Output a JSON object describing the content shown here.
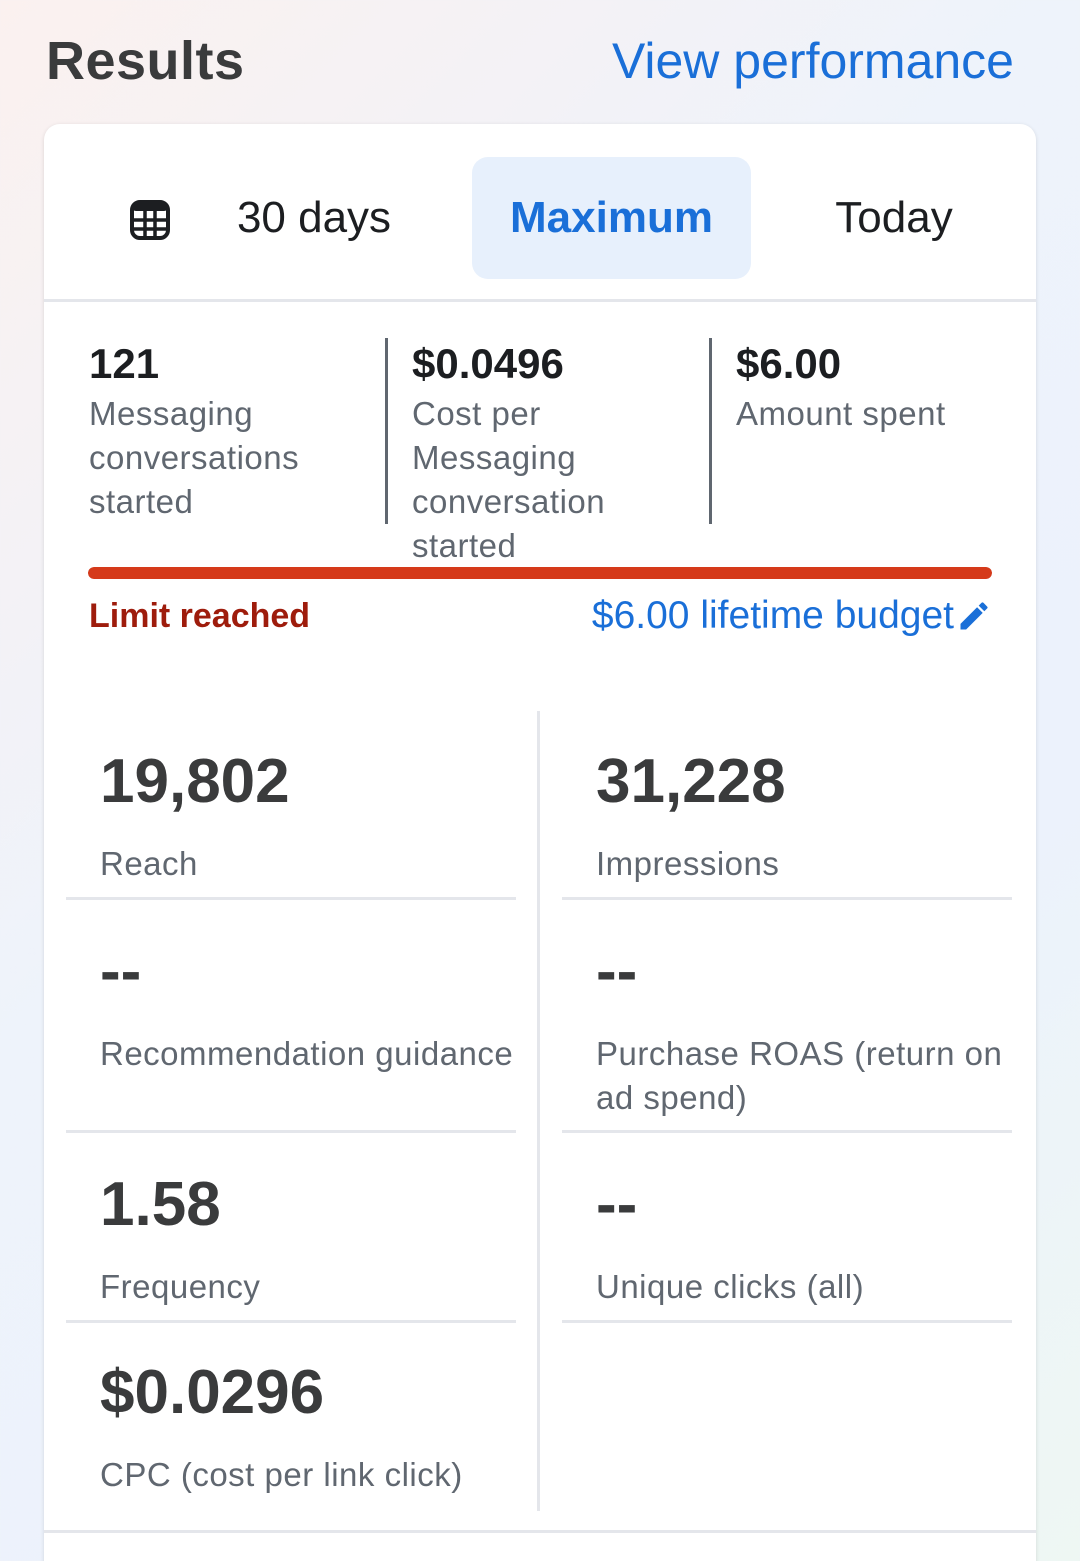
{
  "header": {
    "title": "Results",
    "view_performance": "View performance"
  },
  "date_range": {
    "icon": "calendar-grid-icon",
    "options": [
      "30 days",
      "Maximum",
      "Today"
    ],
    "selected": "Maximum"
  },
  "top_metrics": [
    {
      "value": "121",
      "label": "Messaging conversations started"
    },
    {
      "value": "$0.0496",
      "label": "Cost per Messaging conversation started"
    },
    {
      "value": "$6.00",
      "label": "Amount spent"
    }
  ],
  "budget": {
    "status": "Limit reached",
    "link": "$6.00 lifetime budget",
    "spent_fraction": 1.0,
    "bar_color": "#d53a1a",
    "edit_icon": "pencil-icon"
  },
  "metrics": [
    {
      "value": "19,802",
      "label": "Reach"
    },
    {
      "value": "31,228",
      "label": "Impressions"
    },
    {
      "value": "--",
      "label": "Recommendation guidance"
    },
    {
      "value": "--",
      "label": "Purchase ROAS (return on ad spend)"
    },
    {
      "value": "1.58",
      "label": "Frequency"
    },
    {
      "value": "--",
      "label": "Unique clicks (all)"
    },
    {
      "value": "$0.0296",
      "label": "CPC (cost per link click)"
    }
  ],
  "colors": {
    "accent": "#1a6fd8",
    "selected_bg": "#e7f0fc",
    "limit_text": "#9e1c0c"
  }
}
